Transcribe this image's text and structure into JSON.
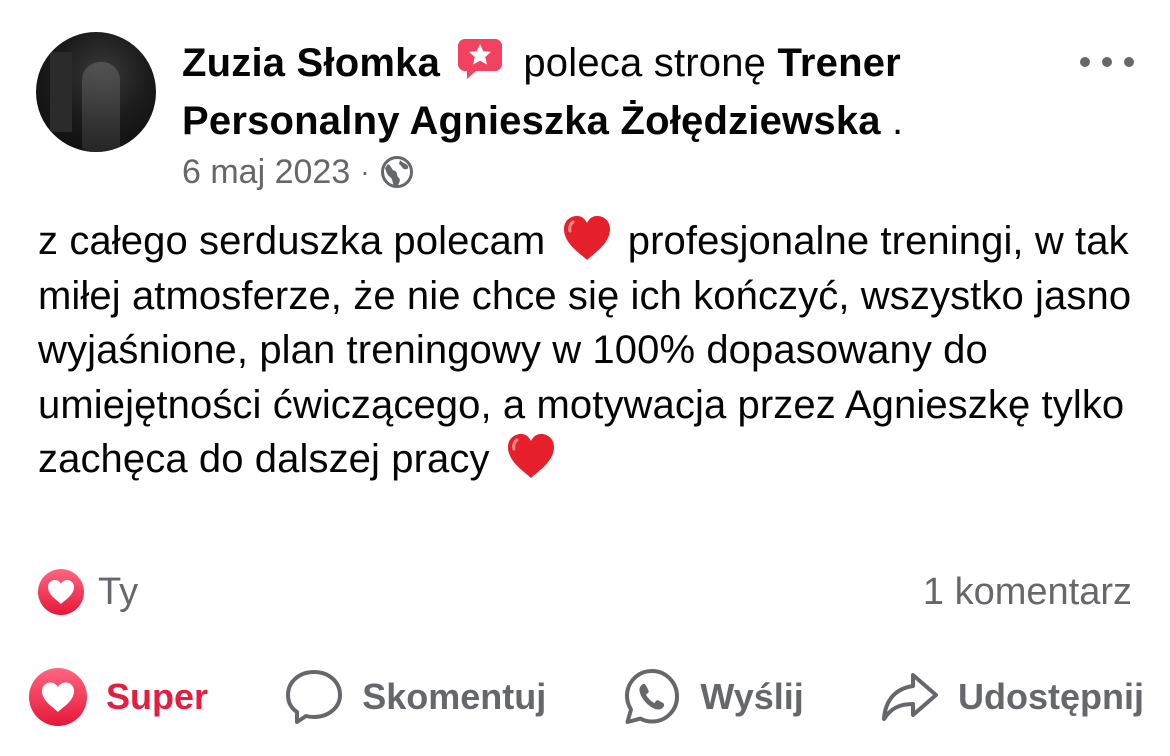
{
  "post": {
    "author": "Zuzia Słomka",
    "recommends_text": "poleca stronę",
    "page_name": "Trener Personalny Agnieszka Żołędziewska",
    "page_suffix": " .",
    "date": "6 maj 2023",
    "separator": "·",
    "privacy_icon": "globe-icon",
    "badge_icon": "recommendation-star-icon",
    "text_parts": [
      "z całego serduszka polecam ",
      " profesjonalne treningi, w tak miłej atmosferze, że nie chce się ich kończyć, wszystko jasno wyjaśnione, plan treningowy w 100% dopasowany do umiejętności ćwiczącego, a motywacja przez Agnieszkę tylko zachęca do dalszej pracy "
    ],
    "emoji": "red-heart-emoji"
  },
  "reactions": {
    "icon": "love-reaction-icon",
    "who": "Ty",
    "comments": "1 komentarz"
  },
  "actions": {
    "love_label": "Super",
    "comment_label": "Skomentuj",
    "send_label": "Wyślij",
    "share_label": "Udostępnij"
  },
  "colors": {
    "accent_red": "#e41e3f",
    "secondary_text": "#65676b",
    "primary_text": "#050505",
    "badge_pink": "#f3425f"
  }
}
